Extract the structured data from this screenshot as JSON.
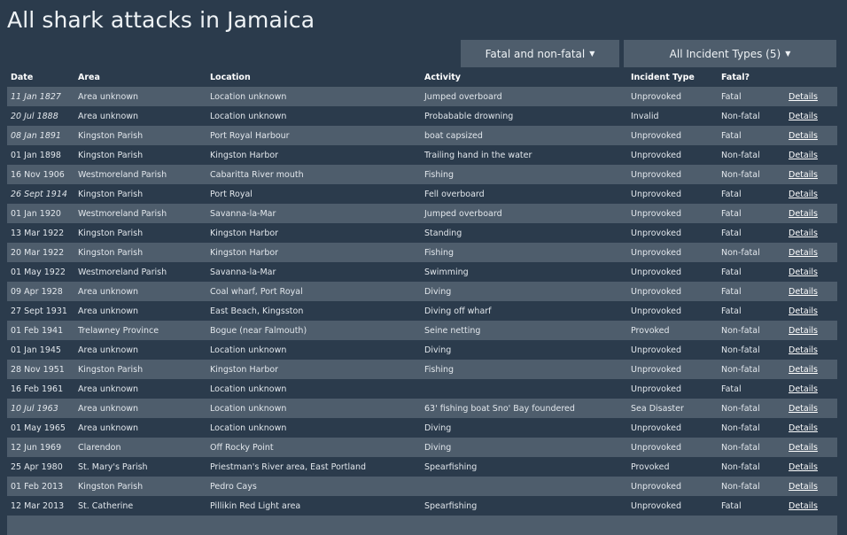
{
  "page": {
    "title": "All shark attacks in Jamaica"
  },
  "filters": {
    "fatal_label": "Fatal and non-fatal",
    "types_label": "All Incident Types (5)"
  },
  "table": {
    "headers": [
      "Date",
      "Area",
      "Location",
      "Activity",
      "Incident Type",
      "Fatal?",
      ""
    ],
    "details_label": "Details",
    "rows": [
      {
        "date": "11 Jan 1827",
        "italic": true,
        "area": "Area unknown",
        "location": "Location unknown",
        "activity": "Jumped overboard",
        "type": "Unprovoked",
        "fatal": "Fatal"
      },
      {
        "date": "20 Jul 1888",
        "italic": true,
        "area": "Area unknown",
        "location": "Location unknown",
        "activity": "Probabable drowning",
        "type": "Invalid",
        "fatal": "Non-fatal"
      },
      {
        "date": "08 Jan 1891",
        "italic": true,
        "area": "Kingston Parish",
        "location": "Port Royal Harbour",
        "activity": "boat capsized",
        "type": "Unprovoked",
        "fatal": "Fatal"
      },
      {
        "date": "01 Jan 1898",
        "italic": false,
        "area": "Kingston Parish",
        "location": "Kingston Harbor",
        "activity": "Trailing hand in the water",
        "type": "Unprovoked",
        "fatal": "Non-fatal"
      },
      {
        "date": "16 Nov 1906",
        "italic": false,
        "area": "Westmoreland Parish",
        "location": "Cabaritta River mouth",
        "activity": "Fishing",
        "type": "Unprovoked",
        "fatal": "Non-fatal"
      },
      {
        "date": "26 Sept 1914",
        "italic": true,
        "area": "Kingston Parish",
        "location": "Port Royal",
        "activity": "Fell overboard",
        "type": "Unprovoked",
        "fatal": "Fatal"
      },
      {
        "date": "01 Jan 1920",
        "italic": false,
        "area": "Westmoreland Parish",
        "location": "Savanna-la-Mar",
        "activity": "Jumped overboard",
        "type": "Unprovoked",
        "fatal": "Fatal"
      },
      {
        "date": "13 Mar 1922",
        "italic": false,
        "area": "Kingston Parish",
        "location": "Kingston Harbor",
        "activity": "Standing",
        "type": "Unprovoked",
        "fatal": "Fatal"
      },
      {
        "date": "20 Mar 1922",
        "italic": false,
        "area": "Kingston Parish",
        "location": "Kingston Harbor",
        "activity": "Fishing",
        "type": "Unprovoked",
        "fatal": "Non-fatal"
      },
      {
        "date": "01 May 1922",
        "italic": false,
        "area": "Westmoreland Parish",
        "location": "Savanna-la-Mar",
        "activity": "Swimming",
        "type": "Unprovoked",
        "fatal": "Fatal"
      },
      {
        "date": "09 Apr 1928",
        "italic": false,
        "area": "Area unknown",
        "location": "Coal wharf, Port Royal",
        "activity": "Diving",
        "type": "Unprovoked",
        "fatal": "Fatal"
      },
      {
        "date": "27 Sept 1931",
        "italic": false,
        "area": "Area unknown",
        "location": "East Beach, Kingsston",
        "activity": "Diving off wharf",
        "type": "Unprovoked",
        "fatal": "Fatal"
      },
      {
        "date": "01 Feb 1941",
        "italic": false,
        "area": "Trelawney Province",
        "location": "Bogue (near Falmouth)",
        "activity": "Seine netting",
        "type": "Provoked",
        "fatal": "Non-fatal"
      },
      {
        "date": "01 Jan 1945",
        "italic": false,
        "area": "Area unknown",
        "location": "Location unknown",
        "activity": "Diving",
        "type": "Unprovoked",
        "fatal": "Non-fatal"
      },
      {
        "date": "28 Nov 1951",
        "italic": false,
        "area": "Kingston Parish",
        "location": "Kingston Harbor",
        "activity": "Fishing",
        "type": "Unprovoked",
        "fatal": "Non-fatal"
      },
      {
        "date": "16 Feb 1961",
        "italic": false,
        "area": "Area unknown",
        "location": "Location unknown",
        "activity": "",
        "type": "Unprovoked",
        "fatal": "Fatal"
      },
      {
        "date": "10 Jul 1963",
        "italic": true,
        "area": "Area unknown",
        "location": "Location unknown",
        "activity": "63' fishing boat Sno' Bay foundered",
        "type": "Sea Disaster",
        "fatal": "Non-fatal"
      },
      {
        "date": "01 May 1965",
        "italic": false,
        "area": "Area unknown",
        "location": "Location unknown",
        "activity": "Diving",
        "type": "Unprovoked",
        "fatal": "Non-fatal"
      },
      {
        "date": "12 Jun 1969",
        "italic": false,
        "area": "Clarendon",
        "location": "Off Rocky Point",
        "activity": "Diving",
        "type": "Unprovoked",
        "fatal": "Non-fatal"
      },
      {
        "date": "25 Apr 1980",
        "italic": false,
        "area": "St. Mary's Parish",
        "location": "Priestman's River area, East Portland",
        "activity": "Spearfishing",
        "type": "Provoked",
        "fatal": "Non-fatal"
      },
      {
        "date": "01 Feb 2013",
        "italic": false,
        "area": "Kingston Parish",
        "location": "Pedro Cays",
        "activity": "",
        "type": "Unprovoked",
        "fatal": "Non-fatal"
      },
      {
        "date": "12 Mar 2013",
        "italic": false,
        "area": "St. Catherine",
        "location": "Pillikin Red Light area",
        "activity": "Spearfishing",
        "type": "Unprovoked",
        "fatal": "Fatal"
      },
      {
        "date": "",
        "italic": false,
        "area": "",
        "location": "",
        "activity": "",
        "type": "",
        "fatal": ""
      }
    ]
  }
}
